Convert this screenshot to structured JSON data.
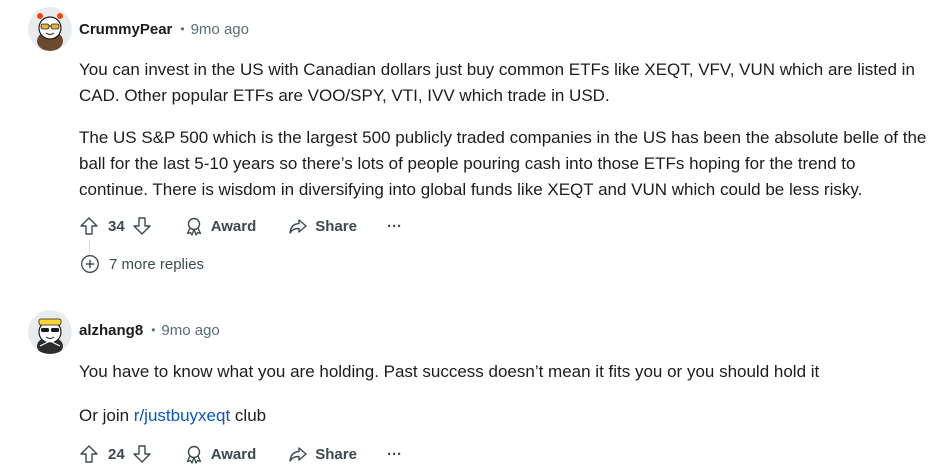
{
  "comments": [
    {
      "username": "CrummyPear",
      "separator": "•",
      "timestamp": "9mo ago",
      "paragraphs": [
        "You can invest in the US with Canadian dollars just buy common ETFs like XEQT, VFV, VUN which are listed in CAD. Other popular ETFs are VOO/SPY, VTI, IVV which trade in USD.",
        "The US S&P 500 which is the largest 500 publicly traded companies in the US has been the absolute belle of the ball for the last 5-10 years so there’s lots of people pouring cash into those ETFs hoping for the trend to continue. There is wisdom in diversifying into global funds like XEQT and VUN which could be less risky."
      ],
      "score": "34",
      "award_label": "Award",
      "share_label": "Share",
      "more_label": "···",
      "more_replies_label": "7 more replies"
    },
    {
      "username": "alzhang8",
      "separator": "•",
      "timestamp": "9mo ago",
      "paragraph1": "You have to know what you are holding. Past success doesn’t mean it fits you or you should hold it",
      "paragraph2_prefix": "Or join ",
      "paragraph2_link": "r/justbuyxeqt",
      "paragraph2_suffix": " club",
      "score": "24",
      "award_label": "Award",
      "share_label": "Share",
      "more_label": "···"
    }
  ],
  "icons": {
    "upvote": "arrow-up-outline-icon",
    "downvote": "arrow-down-outline-icon",
    "award": "award-ribbon-icon",
    "share": "share-arrow-icon",
    "expand": "plus-circle-icon"
  },
  "colors": {
    "text": "#1c1c1c",
    "meta": "#576f76",
    "action": "#3c4a50",
    "link": "#0a56c2"
  }
}
